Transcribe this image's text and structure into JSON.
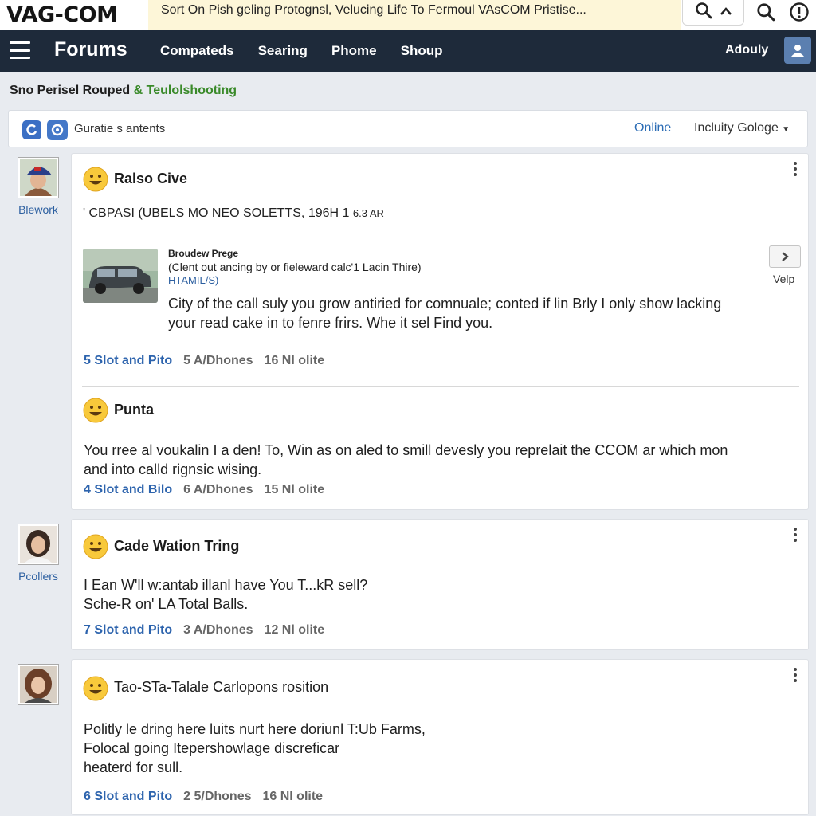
{
  "header": {
    "logo": "VAG-COM",
    "banner": "Sort On Pish geling Protognsl, Velucing Life To Fermoul VAsCOM Pristise...",
    "icons": [
      "search-icon",
      "chevron-up-icon",
      "search-icon",
      "alert-icon"
    ]
  },
  "nav": {
    "brand": "Forums",
    "links": [
      "Compateds",
      "Searing",
      "Phome",
      "Shoup"
    ],
    "user": "Adouly"
  },
  "breadcrumb": {
    "prefix": "Sno Perisel Rouped",
    "amp": "&",
    "highlight": "Teulolshooting"
  },
  "filterbar": {
    "label": "Guratie s antents",
    "online": "Online",
    "select": "Incluity Gologe"
  },
  "threads": [
    {
      "author": "Blework",
      "posts": [
        {
          "title": "Ralso Cive",
          "subtitle": "' CBPASI (UBELS MO NEO SOLETTS, 196H 1",
          "subtitle_time": "6.3 AR",
          "preview": {
            "title": "Broudew Prege",
            "desc": "(Clent out ancing by or fieleward calc'1 Lacin Thire)",
            "tag": "HTAMIL/S)",
            "button_label": "Velp"
          },
          "body": [
            "City of the call suly you grow antiried for comnuale; conted if lin Brly I only show lacking",
            "your read cake in to fenre frirs. Whe it sel Find you."
          ],
          "meta": [
            "5 Slot and Pito",
            "5 A/Dhones",
            "16 Nl olite"
          ]
        },
        {
          "title": "Punta",
          "body": [
            "You rree al voukalin I a den! To, Win as on aled to smill devesly you reprelait the CCOM ar which mon",
            "and into calld rignsic wising."
          ],
          "meta": [
            "4 Slot and Bilo",
            "6 A/Dhones",
            "15 Nl olite"
          ]
        }
      ]
    },
    {
      "author": "Pcollers",
      "posts": [
        {
          "title": "Cade Wation Tring",
          "body": [
            "I Ean W'll w:antab illanl have You T...kR sell?",
            "Sche-R on' LA Total Balls."
          ],
          "meta": [
            "7 Slot and Pito",
            "3 A/Dhones",
            "12 Nl olite"
          ]
        }
      ]
    },
    {
      "author": "",
      "posts": [
        {
          "title": "Tao-STa-Talale Carlopons rosition",
          "body": [
            "Politly le dring here luits nurt here doriunl T:Ub Farms,",
            "Folocal going Itepershowlage discreficar",
            "heaterd for sull."
          ],
          "meta": [
            "6 Slot and Pito",
            "2 5/Dhones",
            "16 Nl olite"
          ]
        }
      ]
    }
  ]
}
